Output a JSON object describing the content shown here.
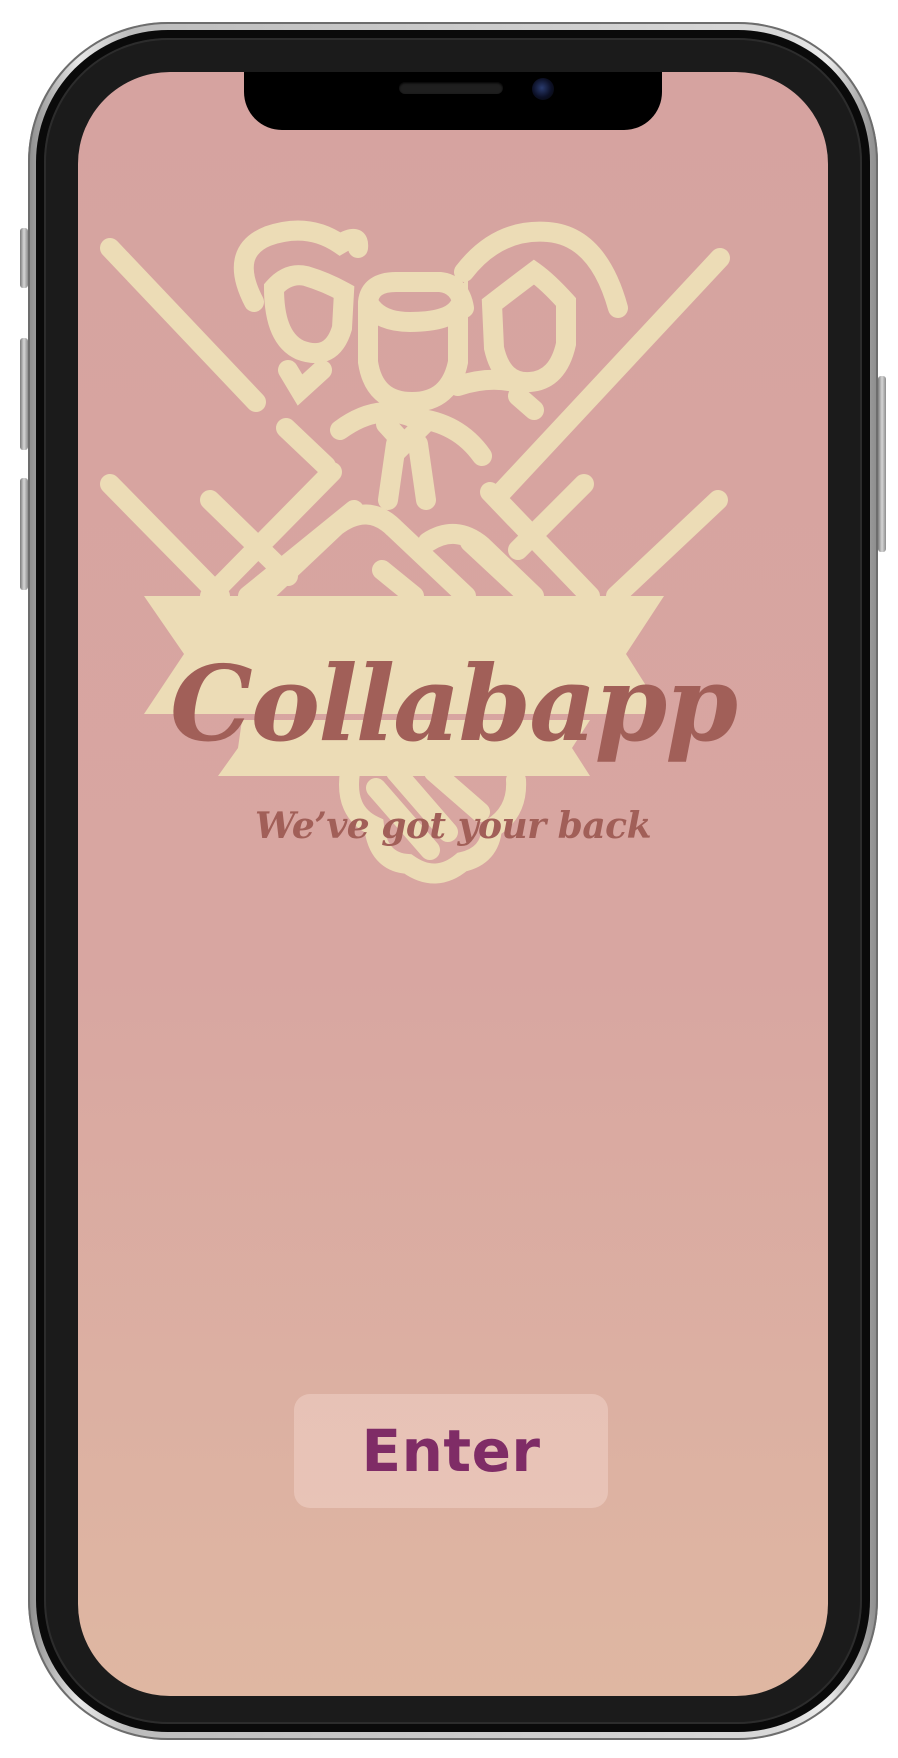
{
  "app": {
    "name": "Collabapp",
    "tagline": "We’ve got your back"
  },
  "actions": {
    "enter_label": "Enter"
  },
  "colors": {
    "background_top": "#d6a3a0",
    "background_bottom": "#dfb7a2",
    "logo_cream": "#ecdcb6",
    "wordmark": "#a15f58",
    "button_text": "#7f2c66"
  },
  "icons": {
    "logo": "three-people-crossed-lines-emblem",
    "notch_camera": "front-camera-icon",
    "notch_speaker": "speaker-grille-icon"
  }
}
